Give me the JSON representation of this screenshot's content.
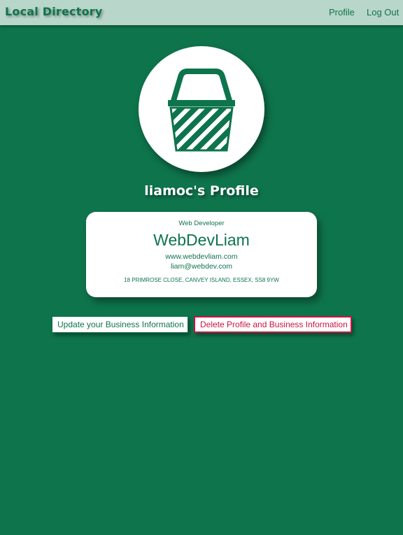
{
  "navbar": {
    "brand": "Local Directory",
    "links": [
      {
        "label": "Profile"
      },
      {
        "label": "Log Out"
      }
    ]
  },
  "profile": {
    "title": "liamoc's Profile",
    "avatar_icon": "basket-icon"
  },
  "business_card": {
    "category": "Web Developer",
    "name": "WebDevLiam",
    "website": "www.webdevliam.com",
    "email": "liam@webdev.com",
    "address": "18 PRIMROSE CLOSE, CANVEY ISLAND, ESSEX, SS8 9YW"
  },
  "actions": {
    "update_label": "Update your Business Information",
    "delete_label": "Delete Profile and Business Information"
  },
  "colors": {
    "background": "#0e744c",
    "navbar": "#b8d6c9",
    "accent": "#0e744c",
    "danger": "#cc1240",
    "card": "#ffffff"
  }
}
